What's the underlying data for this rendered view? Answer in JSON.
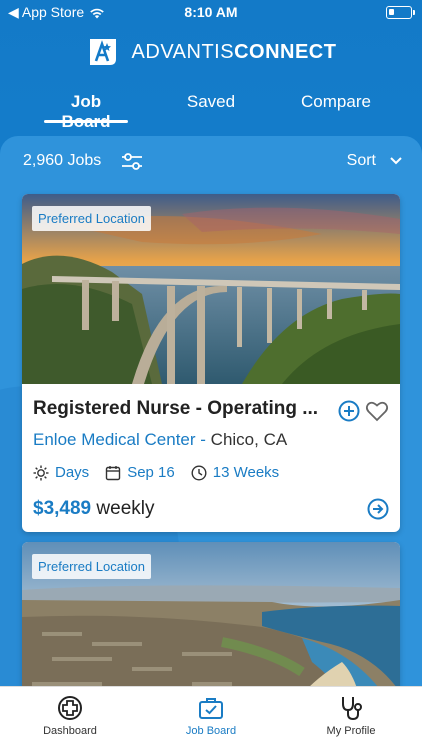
{
  "status_bar": {
    "back_label": "◀ App Store",
    "time": "8:10 AM"
  },
  "brand": {
    "name_light": "ADVANTIS",
    "name_bold": "CONNECT"
  },
  "tabs": [
    {
      "label": "Job Board",
      "active": true
    },
    {
      "label": "Saved",
      "active": false
    },
    {
      "label": "Compare",
      "active": false
    }
  ],
  "toolbar": {
    "job_count": "2,960 Jobs",
    "sort_label": "Sort"
  },
  "jobs": [
    {
      "badge": "Preferred Location",
      "title": "Registered Nurse - Operating ...",
      "facility": "Enloe Medical Center",
      "separator": "-",
      "location": "Chico, CA",
      "shift": "Days",
      "start_date": "Sep 16",
      "duration": "13 Weeks",
      "pay_amount": "$3,489",
      "pay_period": "weekly"
    },
    {
      "badge": "Preferred Location"
    }
  ],
  "bottom_nav": [
    {
      "label": "Dashboard",
      "icon": "plus-circle-icon",
      "active": false
    },
    {
      "label": "Job Board",
      "icon": "briefcase-icon",
      "active": true
    },
    {
      "label": "My Profile",
      "icon": "stethoscope-icon",
      "active": false
    }
  ],
  "colors": {
    "brand_blue": "#137ac8",
    "accent_blue": "#1a7cc4",
    "white": "#ffffff"
  }
}
